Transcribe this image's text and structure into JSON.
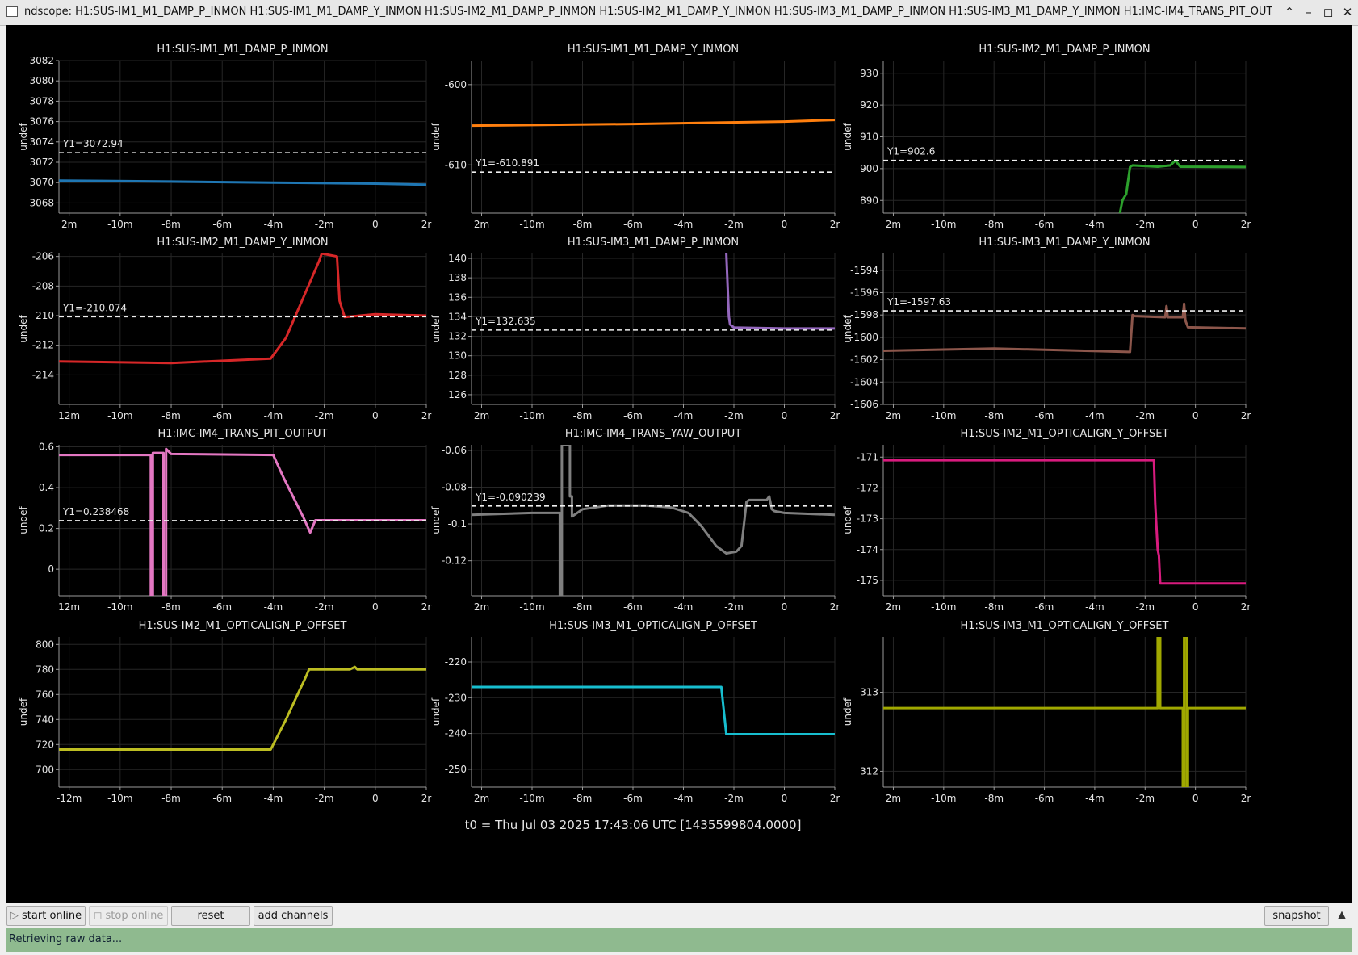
{
  "window": {
    "title": "ndscope: H1:SUS-IM1_M1_DAMP_P_INMON H1:SUS-IM1_M1_DAMP_Y_INMON H1:SUS-IM2_M1_DAMP_P_INMON H1:SUS-IM2_M1_DAMP_Y_INMON H1:SUS-IM3_M1_DAMP_P_INMON H1:SUS-IM3_M1_DAMP_Y_INMON H1:IMC-IM4_TRANS_PIT_OUTPUT H1:IMC-IM4_TRA",
    "min_icon": "minimize-icon",
    "max_icon": "maximize-icon",
    "close_icon": "close-icon"
  },
  "footer_t0": "t0 = Thu Jul 03 2025 17:43:06 UTC [1435599804.0000]",
  "toolbar": {
    "start_online": "start online",
    "stop_online": "stop online",
    "reset": "reset",
    "add_channels": "add channels",
    "snapshot": "snapshot"
  },
  "status": "Retrieving raw data...",
  "chart_data": [
    {
      "type": "line",
      "title": "H1:SUS-IM1_M1_DAMP_P_INMON",
      "ylabel": "undef",
      "color": "#1f77b4",
      "yticks": [
        3068,
        3070,
        3072,
        3074,
        3076,
        3078,
        3080,
        3082
      ],
      "ylim": [
        3067,
        3082
      ],
      "xticks": [
        "2m",
        "-10m",
        "-8m",
        "-6m",
        "-4m",
        "-2m",
        "0",
        "2r"
      ],
      "xlim": [
        -12.4,
        2
      ],
      "cursor": 3072.94,
      "cursor_label": "Y1=3072.94",
      "x": [
        -12.4,
        -8,
        -4,
        0,
        2
      ],
      "y": [
        3070.2,
        3070.1,
        3070.0,
        3069.9,
        3069.8
      ]
    },
    {
      "type": "line",
      "title": "H1:SUS-IM1_M1_DAMP_Y_INMON",
      "ylabel": "undef",
      "color": "#ff7f0e",
      "yticks": [
        -600,
        -610
      ],
      "ylim": [
        -616,
        -597
      ],
      "xticks": [
        "2m",
        "-10m",
        "-8m",
        "-6m",
        "-4m",
        "-2m",
        "0",
        "2r"
      ],
      "xlim": [
        -12.4,
        2
      ],
      "cursor": -610.891,
      "cursor_label": "Y1=-610.891",
      "x": [
        -12.4,
        -6,
        0,
        2
      ],
      "y": [
        -605.1,
        -604.9,
        -604.6,
        -604.4
      ]
    },
    {
      "type": "line",
      "title": "H1:SUS-IM2_M1_DAMP_P_INMON",
      "ylabel": "undef",
      "color": "#2ca02c",
      "yticks": [
        890,
        900,
        910,
        920,
        930
      ],
      "ylim": [
        886,
        934
      ],
      "xticks": [
        "2m",
        "-10m",
        "-8m",
        "-6m",
        "-4m",
        "-2m",
        "0",
        "2r"
      ],
      "xlim": [
        -12.4,
        2
      ],
      "cursor": 902.6,
      "cursor_label": "Y1=902.6",
      "x": [
        -3.0,
        -2.9,
        -2.75,
        -2.6,
        -2.5,
        -1.5,
        -1.0,
        -0.8,
        -0.6,
        2
      ],
      "y": [
        886,
        890,
        892,
        900.5,
        901,
        900.6,
        901,
        902.5,
        900.6,
        900.5
      ]
    },
    {
      "type": "line",
      "title": "H1:SUS-IM2_M1_DAMP_Y_INMON",
      "ylabel": "undef",
      "color": "#d62728",
      "yticks": [
        -206,
        -208,
        -210,
        -212,
        -214
      ],
      "ylim": [
        -216,
        -205.8
      ],
      "xticks": [
        "12m",
        "-10m",
        "-8m",
        "-6m",
        "-4m",
        "-2m",
        "0",
        "2r"
      ],
      "xlim": [
        -12.4,
        2
      ],
      "cursor": -210.074,
      "cursor_label": "Y1=-210.074",
      "x": [
        -12.4,
        -8,
        -4.1,
        -3.5,
        -3,
        -2.5,
        -2.2,
        -2.1,
        -1.5,
        -1.4,
        -1.2,
        0,
        2
      ],
      "y": [
        -213.1,
        -213.2,
        -212.9,
        -211.5,
        -209.5,
        -207.5,
        -206.3,
        -205.8,
        -206,
        -209,
        -210.1,
        -209.9,
        -210
      ]
    },
    {
      "type": "line",
      "title": "H1:SUS-IM3_M1_DAMP_P_INMON",
      "ylabel": "undef",
      "color": "#9467bd",
      "yticks": [
        126,
        128,
        130,
        132,
        134,
        136,
        138,
        140
      ],
      "ylim": [
        125,
        140.5
      ],
      "xticks": [
        "2m",
        "-10m",
        "-8m",
        "-6m",
        "-4m",
        "-2m",
        "0",
        "2r"
      ],
      "xlim": [
        -12.4,
        2
      ],
      "cursor": 132.635,
      "cursor_label": "Y1=132.635",
      "x": [
        -2.3,
        -2.2,
        -2.15,
        -2.0,
        0,
        2
      ],
      "y": [
        140.5,
        134,
        133.2,
        132.9,
        132.8,
        132.8
      ]
    },
    {
      "type": "line",
      "title": "H1:SUS-IM3_M1_DAMP_Y_INMON",
      "ylabel": "undef",
      "color": "#8c564b",
      "yticks": [
        -1594,
        -1596,
        -1598,
        -1600,
        -1602,
        -1604,
        -1606
      ],
      "ylim": [
        -1606,
        -1592.5
      ],
      "xticks": [
        "2m",
        "-10m",
        "-8m",
        "-6m",
        "-4m",
        "-2m",
        "0",
        "2r"
      ],
      "xlim": [
        -12.4,
        2
      ],
      "cursor": -1597.63,
      "cursor_label": "Y1=-1597.63",
      "x": [
        -12.4,
        -8,
        -2.6,
        -2.5,
        -2.4,
        -1.2,
        -1.15,
        -1.1,
        -0.5,
        -0.45,
        -0.4,
        -0.3,
        2
      ],
      "y": [
        -1601.2,
        -1601,
        -1601.3,
        -1598,
        -1598.1,
        -1598.2,
        -1597.2,
        -1598.2,
        -1598.2,
        -1597,
        -1598.5,
        -1599.1,
        -1599.2
      ]
    },
    {
      "type": "line",
      "title": "H1:IMC-IM4_TRANS_PIT_OUTPUT",
      "ylabel": "undef",
      "color": "#e377c2",
      "yticks": [
        0,
        0.2,
        0.4,
        0.6
      ],
      "ylim": [
        -0.13,
        0.61
      ],
      "xticks": [
        "12m",
        "-10m",
        "-8m",
        "-6m",
        "-4m",
        "-2m",
        "0",
        "2r"
      ],
      "xlim": [
        -12.4,
        2
      ],
      "cursor": 0.238468,
      "cursor_label": "Y1=0.238468",
      "x": [
        -12.4,
        -8.8,
        -8.8,
        -8.72,
        -8.72,
        -8.3,
        -8.3,
        -8.2,
        -8.2,
        -8.0,
        -4.0,
        -3.6,
        -3.2,
        -2.8,
        -2.55,
        -2.35,
        -2.2,
        0,
        2
      ],
      "y": [
        0.56,
        0.56,
        -0.13,
        -0.13,
        0.57,
        0.57,
        -0.13,
        -0.13,
        0.59,
        0.565,
        0.56,
        0.45,
        0.35,
        0.25,
        0.18,
        0.24,
        0.24,
        0.24,
        0.24
      ]
    },
    {
      "type": "line",
      "title": "H1:IMC-IM4_TRANS_YAW_OUTPUT",
      "ylabel": "undef",
      "color": "#7f7f7f",
      "yticks": [
        -0.06,
        -0.08,
        -0.1,
        -0.12
      ],
      "ylim": [
        -0.139,
        -0.057
      ],
      "xticks": [
        "2m",
        "-10m",
        "-8m",
        "-6m",
        "-4m",
        "-2m",
        "0",
        "2r"
      ],
      "xlim": [
        -12.4,
        2
      ],
      "cursor": -0.090239,
      "cursor_label": "Y1=-0.090239",
      "x": [
        -12.4,
        -10,
        -8.9,
        -8.9,
        -8.82,
        -8.82,
        -8.5,
        -8.5,
        -8.42,
        -8.42,
        -8.0,
        -7.0,
        -5.5,
        -4.5,
        -3.8,
        -3.3,
        -2.7,
        -2.3,
        -1.9,
        -1.7,
        -1.5,
        -1.4,
        -0.7,
        -0.6,
        -0.5,
        -0.4,
        0,
        2
      ],
      "y": [
        -0.095,
        -0.094,
        -0.094,
        -0.139,
        -0.139,
        -0.057,
        -0.057,
        -0.085,
        -0.085,
        -0.096,
        -0.092,
        -0.09,
        -0.09,
        -0.091,
        -0.094,
        -0.101,
        -0.112,
        -0.116,
        -0.115,
        -0.112,
        -0.088,
        -0.087,
        -0.087,
        -0.085,
        -0.092,
        -0.093,
        -0.094,
        -0.095
      ]
    },
    {
      "type": "line",
      "title": "H1:SUS-IM2_M1_OPTICALIGN_Y_OFFSET",
      "ylabel": "undef",
      "color": "#d81b7e",
      "yticks": [
        -171,
        -172,
        -173,
        -174,
        -175
      ],
      "ylim": [
        -175.5,
        -170.6
      ],
      "xticks": [
        "2m",
        "-10m",
        "-8m",
        "-6m",
        "-4m",
        "-2m",
        "0",
        "2r"
      ],
      "xlim": [
        -12.4,
        2
      ],
      "cursor": null,
      "cursor_label": "",
      "x": [
        -12.4,
        -1.65,
        -1.6,
        -1.5,
        -1.45,
        -1.4,
        2
      ],
      "y": [
        -171.1,
        -171.1,
        -172.5,
        -174,
        -174.2,
        -175.1,
        -175.1
      ]
    },
    {
      "type": "line",
      "title": "H1:SUS-IM2_M1_OPTICALIGN_P_OFFSET",
      "ylabel": "undef",
      "color": "#bcbd22",
      "yticks": [
        700,
        720,
        740,
        760,
        780,
        800
      ],
      "ylim": [
        686,
        806
      ],
      "xticks": [
        "-12m",
        "-10m",
        "-8m",
        "-6m",
        "-4m",
        "-2m",
        "0",
        "2r"
      ],
      "xlim": [
        -12.4,
        2
      ],
      "cursor": null,
      "cursor_label": "",
      "x": [
        -12.4,
        -4.1,
        -3.5,
        -3,
        -2.7,
        -2.6,
        -1.0,
        -0.8,
        -0.7,
        2
      ],
      "y": [
        716,
        716,
        740,
        762,
        775,
        780,
        780,
        782,
        780,
        780
      ]
    },
    {
      "type": "line",
      "title": "H1:SUS-IM3_M1_OPTICALIGN_P_OFFSET",
      "ylabel": "undef",
      "color": "#17becf",
      "yticks": [
        -220,
        -230,
        -240,
        -250
      ],
      "ylim": [
        -255,
        -213
      ],
      "xticks": [
        "2m",
        "-10m",
        "-8m",
        "-6m",
        "-4m",
        "-2m",
        "0",
        "2r"
      ],
      "xlim": [
        -12.4,
        2
      ],
      "cursor": null,
      "cursor_label": "",
      "x": [
        -12.4,
        -2.5,
        -2.3,
        2
      ],
      "y": [
        -227,
        -227,
        -240.2,
        -240.2
      ]
    },
    {
      "type": "line",
      "title": "H1:SUS-IM3_M1_OPTICALIGN_Y_OFFSET",
      "ylabel": "undef",
      "color": "#a0a800",
      "yticks": [
        312,
        313
      ],
      "ylim": [
        311.8,
        313.7
      ],
      "xticks": [
        "2m",
        "-10m",
        "-8m",
        "-6m",
        "-4m",
        "-2m",
        "0",
        "2r"
      ],
      "xlim": [
        -12.4,
        2
      ],
      "cursor": null,
      "cursor_label": "",
      "x": [
        -12.4,
        -1.5,
        -1.5,
        -1.4,
        -1.4,
        -0.5,
        -0.5,
        -0.45,
        -0.45,
        -0.35,
        -0.35,
        -0.3,
        -0.3,
        2
      ],
      "y": [
        312.8,
        312.8,
        313.7,
        313.7,
        312.8,
        312.8,
        311.8,
        311.8,
        313.7,
        313.7,
        311.8,
        311.8,
        312.8,
        312.8
      ]
    }
  ]
}
